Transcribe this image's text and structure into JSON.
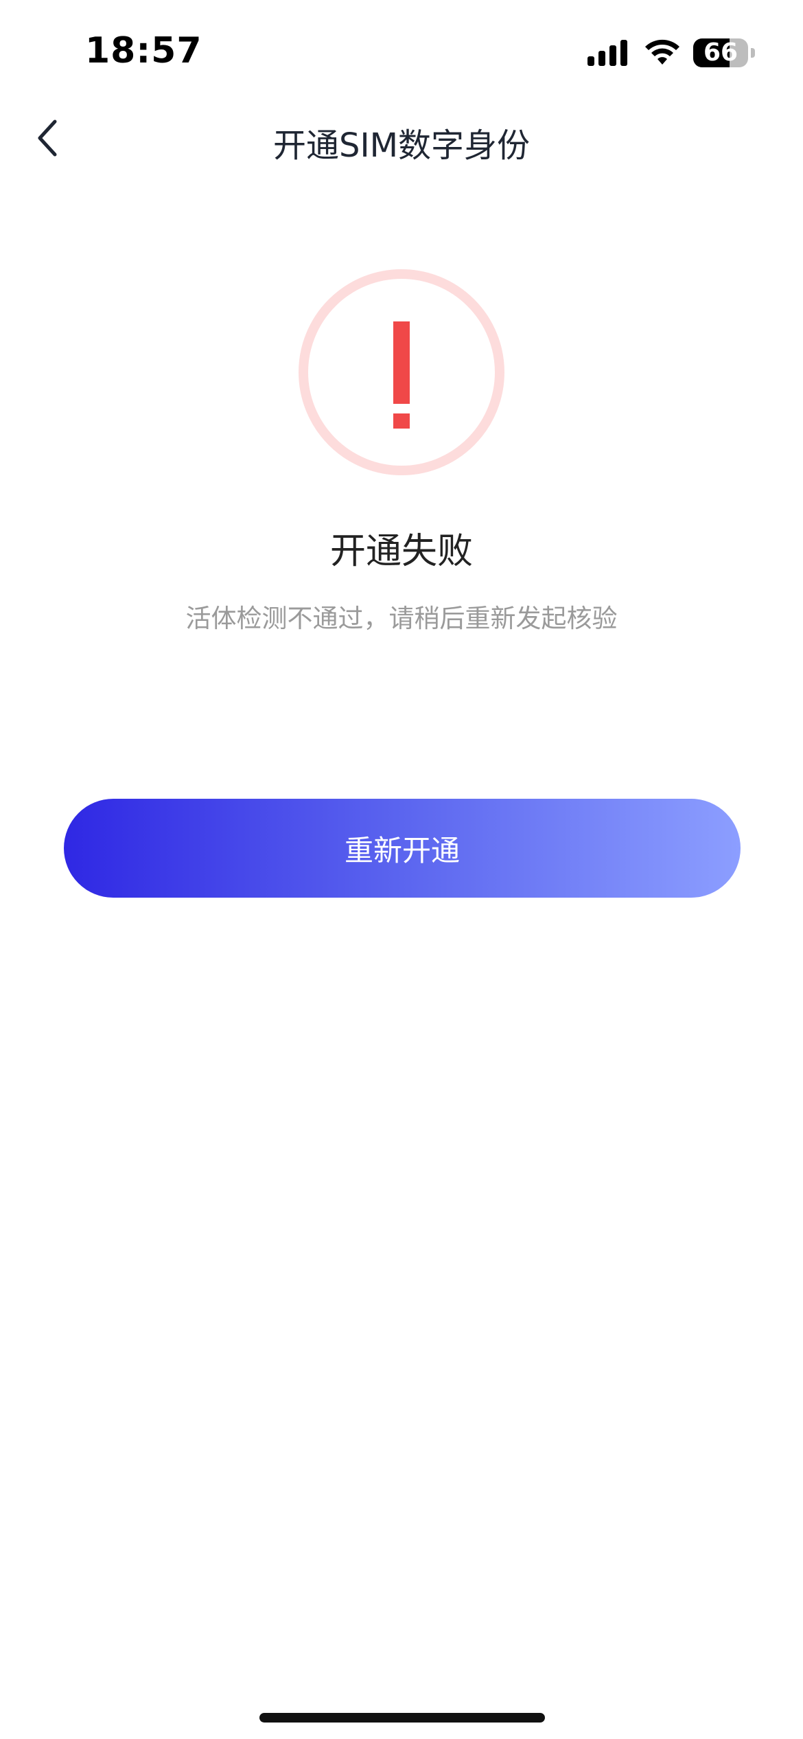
{
  "status_bar": {
    "time": "18:57",
    "battery_level": "66",
    "icons": [
      "signal-icon",
      "wifi-icon",
      "battery-icon"
    ]
  },
  "nav": {
    "back_icon": "chevron-left-icon",
    "title": "开通SIM数字身份"
  },
  "result": {
    "icon": "exclamation-circle-icon",
    "title": "开通失败",
    "description": "活体检测不通过，请稍后重新发起核验"
  },
  "actions": {
    "retry_label": "重新开通"
  },
  "colors": {
    "error_ring": "#fddcdc",
    "error_mark": "#f04848",
    "button_gradient_start": "#2f28e4",
    "button_gradient_end": "#8c9eff",
    "title_text": "#1f2633",
    "desc_text": "#9a9a9a"
  }
}
